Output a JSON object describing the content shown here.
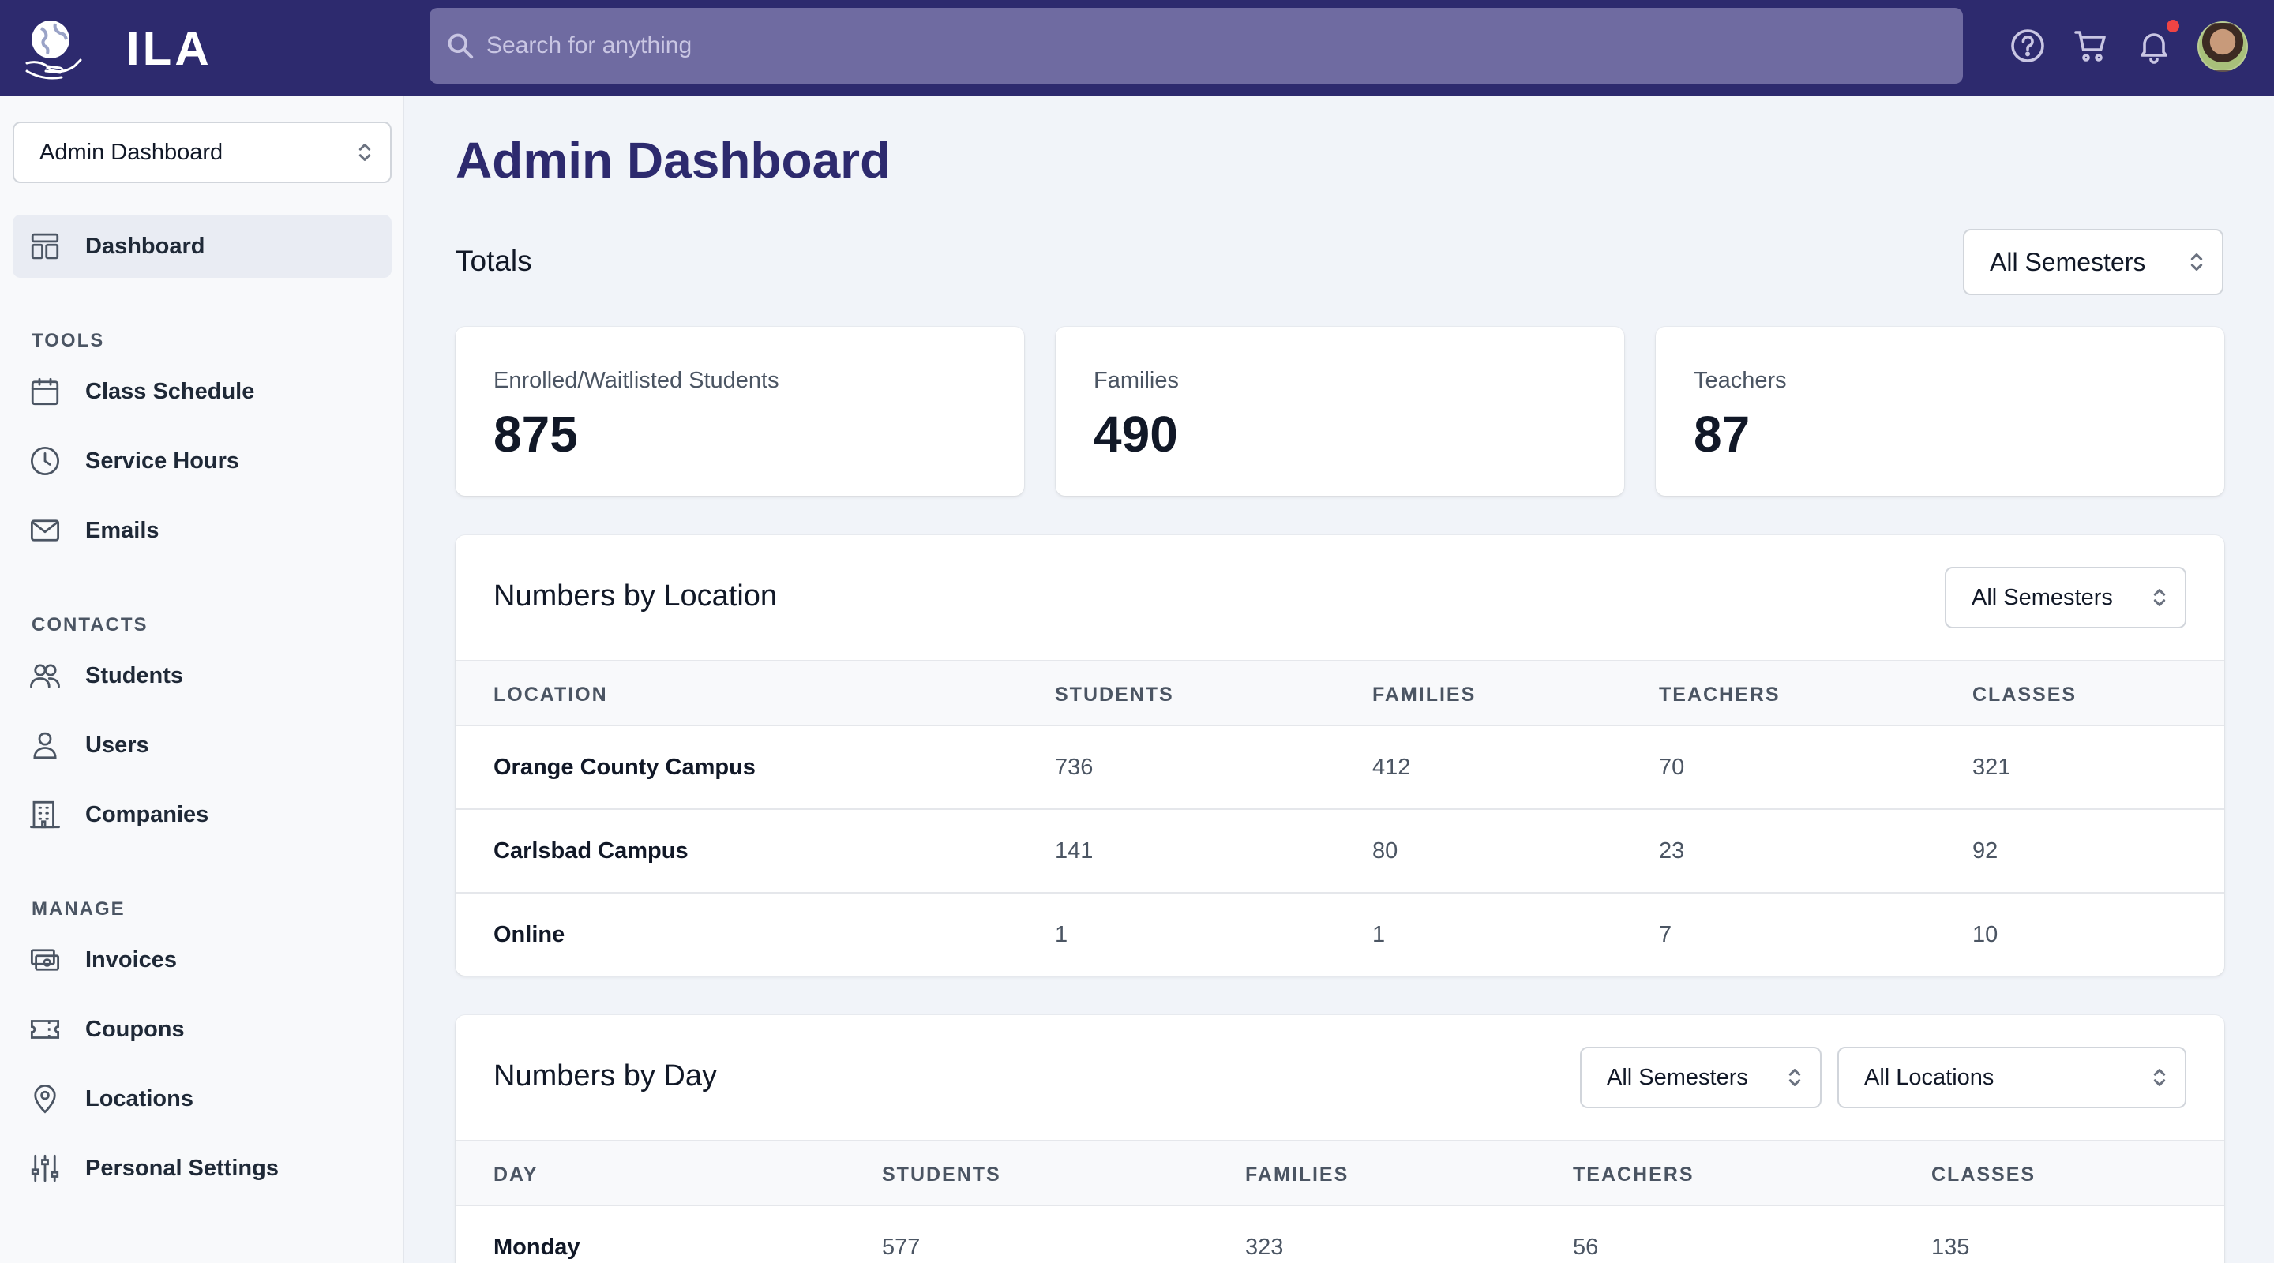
{
  "app": {
    "name": "ILA"
  },
  "search": {
    "placeholder": "Search for anything"
  },
  "header_icons": [
    "help-icon",
    "cart-icon",
    "bell-icon",
    "user-avatar"
  ],
  "sidebar": {
    "view_select": "Admin Dashboard",
    "dashboard_label": "Dashboard",
    "sections": {
      "tools": "TOOLS",
      "contacts": "CONTACTS",
      "manage": "MANAGE"
    },
    "items": {
      "class_schedule": "Class Schedule",
      "service_hours": "Service Hours",
      "emails": "Emails",
      "students": "Students",
      "users": "Users",
      "companies": "Companies",
      "invoices": "Invoices",
      "coupons": "Coupons",
      "locations": "Locations",
      "personal_settings": "Personal Settings"
    }
  },
  "main": {
    "title": "Admin Dashboard",
    "totals": {
      "label": "Totals",
      "semester_filter": "All Semesters",
      "cards": [
        {
          "label": "Enrolled/Waitlisted Students",
          "value": "875"
        },
        {
          "label": "Families",
          "value": "490"
        },
        {
          "label": "Teachers",
          "value": "87"
        }
      ]
    },
    "by_location": {
      "title": "Numbers by Location",
      "semester_filter": "All Semesters",
      "columns": [
        "LOCATION",
        "STUDENTS",
        "FAMILIES",
        "TEACHERS",
        "CLASSES"
      ],
      "rows": [
        [
          "Orange County Campus",
          "736",
          "412",
          "70",
          "321"
        ],
        [
          "Carlsbad Campus",
          "141",
          "80",
          "23",
          "92"
        ],
        [
          "Online",
          "1",
          "1",
          "7",
          "10"
        ]
      ]
    },
    "by_day": {
      "title": "Numbers by Day",
      "semester_filter": "All Semesters",
      "location_filter": "All Locations",
      "columns": [
        "DAY",
        "STUDENTS",
        "FAMILIES",
        "TEACHERS",
        "CLASSES"
      ],
      "rows": [
        [
          "Monday",
          "577",
          "323",
          "56",
          "135"
        ]
      ]
    }
  },
  "colors": {
    "header_bg": "#2d2a6e",
    "search_bg": "#6f6ba1",
    "title": "#2d2a6e",
    "notification": "#ef4444",
    "page_bg": "#f1f4f9"
  }
}
